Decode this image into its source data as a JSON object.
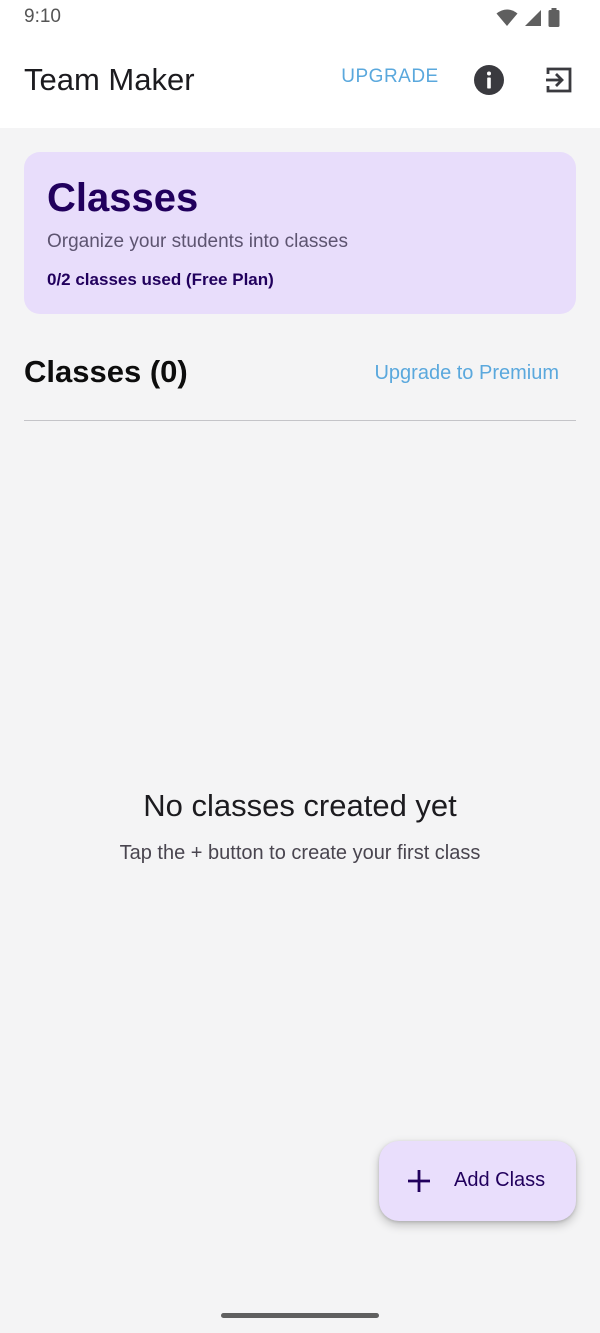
{
  "status_bar": {
    "time": "9:10",
    "icons": [
      "wifi-icon",
      "signal-icon",
      "battery-icon"
    ]
  },
  "app_bar": {
    "title": "Team Maker",
    "upgrade_label": "UPGRADE",
    "icons": [
      "info-icon",
      "logout-icon"
    ]
  },
  "header_card": {
    "title": "Classes",
    "subtitle": "Organize your students into classes",
    "usage": "0/2 classes used (Free Plan)"
  },
  "section": {
    "title": "Classes (0)",
    "premium_link": "Upgrade to Premium"
  },
  "empty_state": {
    "title": "No classes created yet",
    "hint": "Tap the + button to create your first class"
  },
  "fab": {
    "label": "Add Class",
    "icon": "plus-icon"
  },
  "colors": {
    "accent_link": "#5aa8dd",
    "card_background": "#e8ddfb",
    "card_title": "#21005d",
    "page_background": "#f4f4f5"
  }
}
